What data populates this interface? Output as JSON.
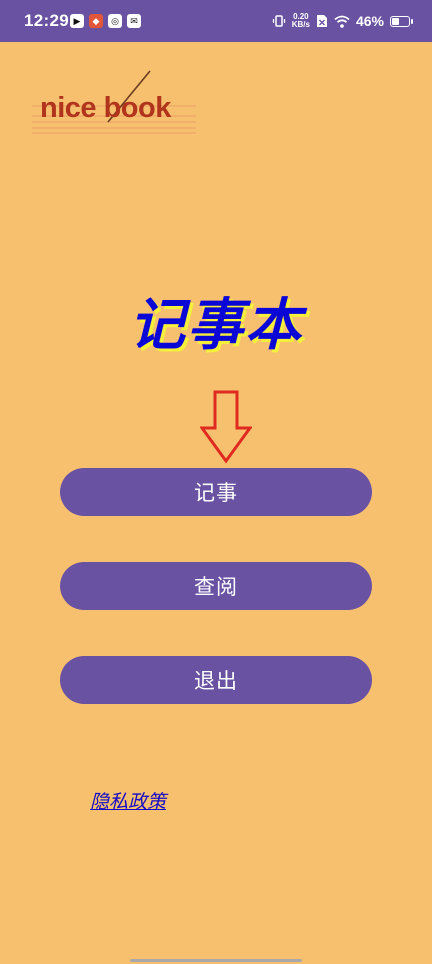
{
  "status_bar": {
    "time": "12:29",
    "net_speed_value": "0.20",
    "net_speed_unit": "KB/s",
    "battery": "46%"
  },
  "logo": {
    "text": "nice book"
  },
  "app": {
    "title": "记事本"
  },
  "buttons": {
    "record": "记事",
    "view": "查阅",
    "exit": "退出"
  },
  "privacy_link": "隐私政策",
  "colors": {
    "background": "#f7c06e",
    "accent": "#6a52a3",
    "title": "#0a06d6",
    "logo": "#b1351c",
    "arrow": "#e02a20"
  }
}
